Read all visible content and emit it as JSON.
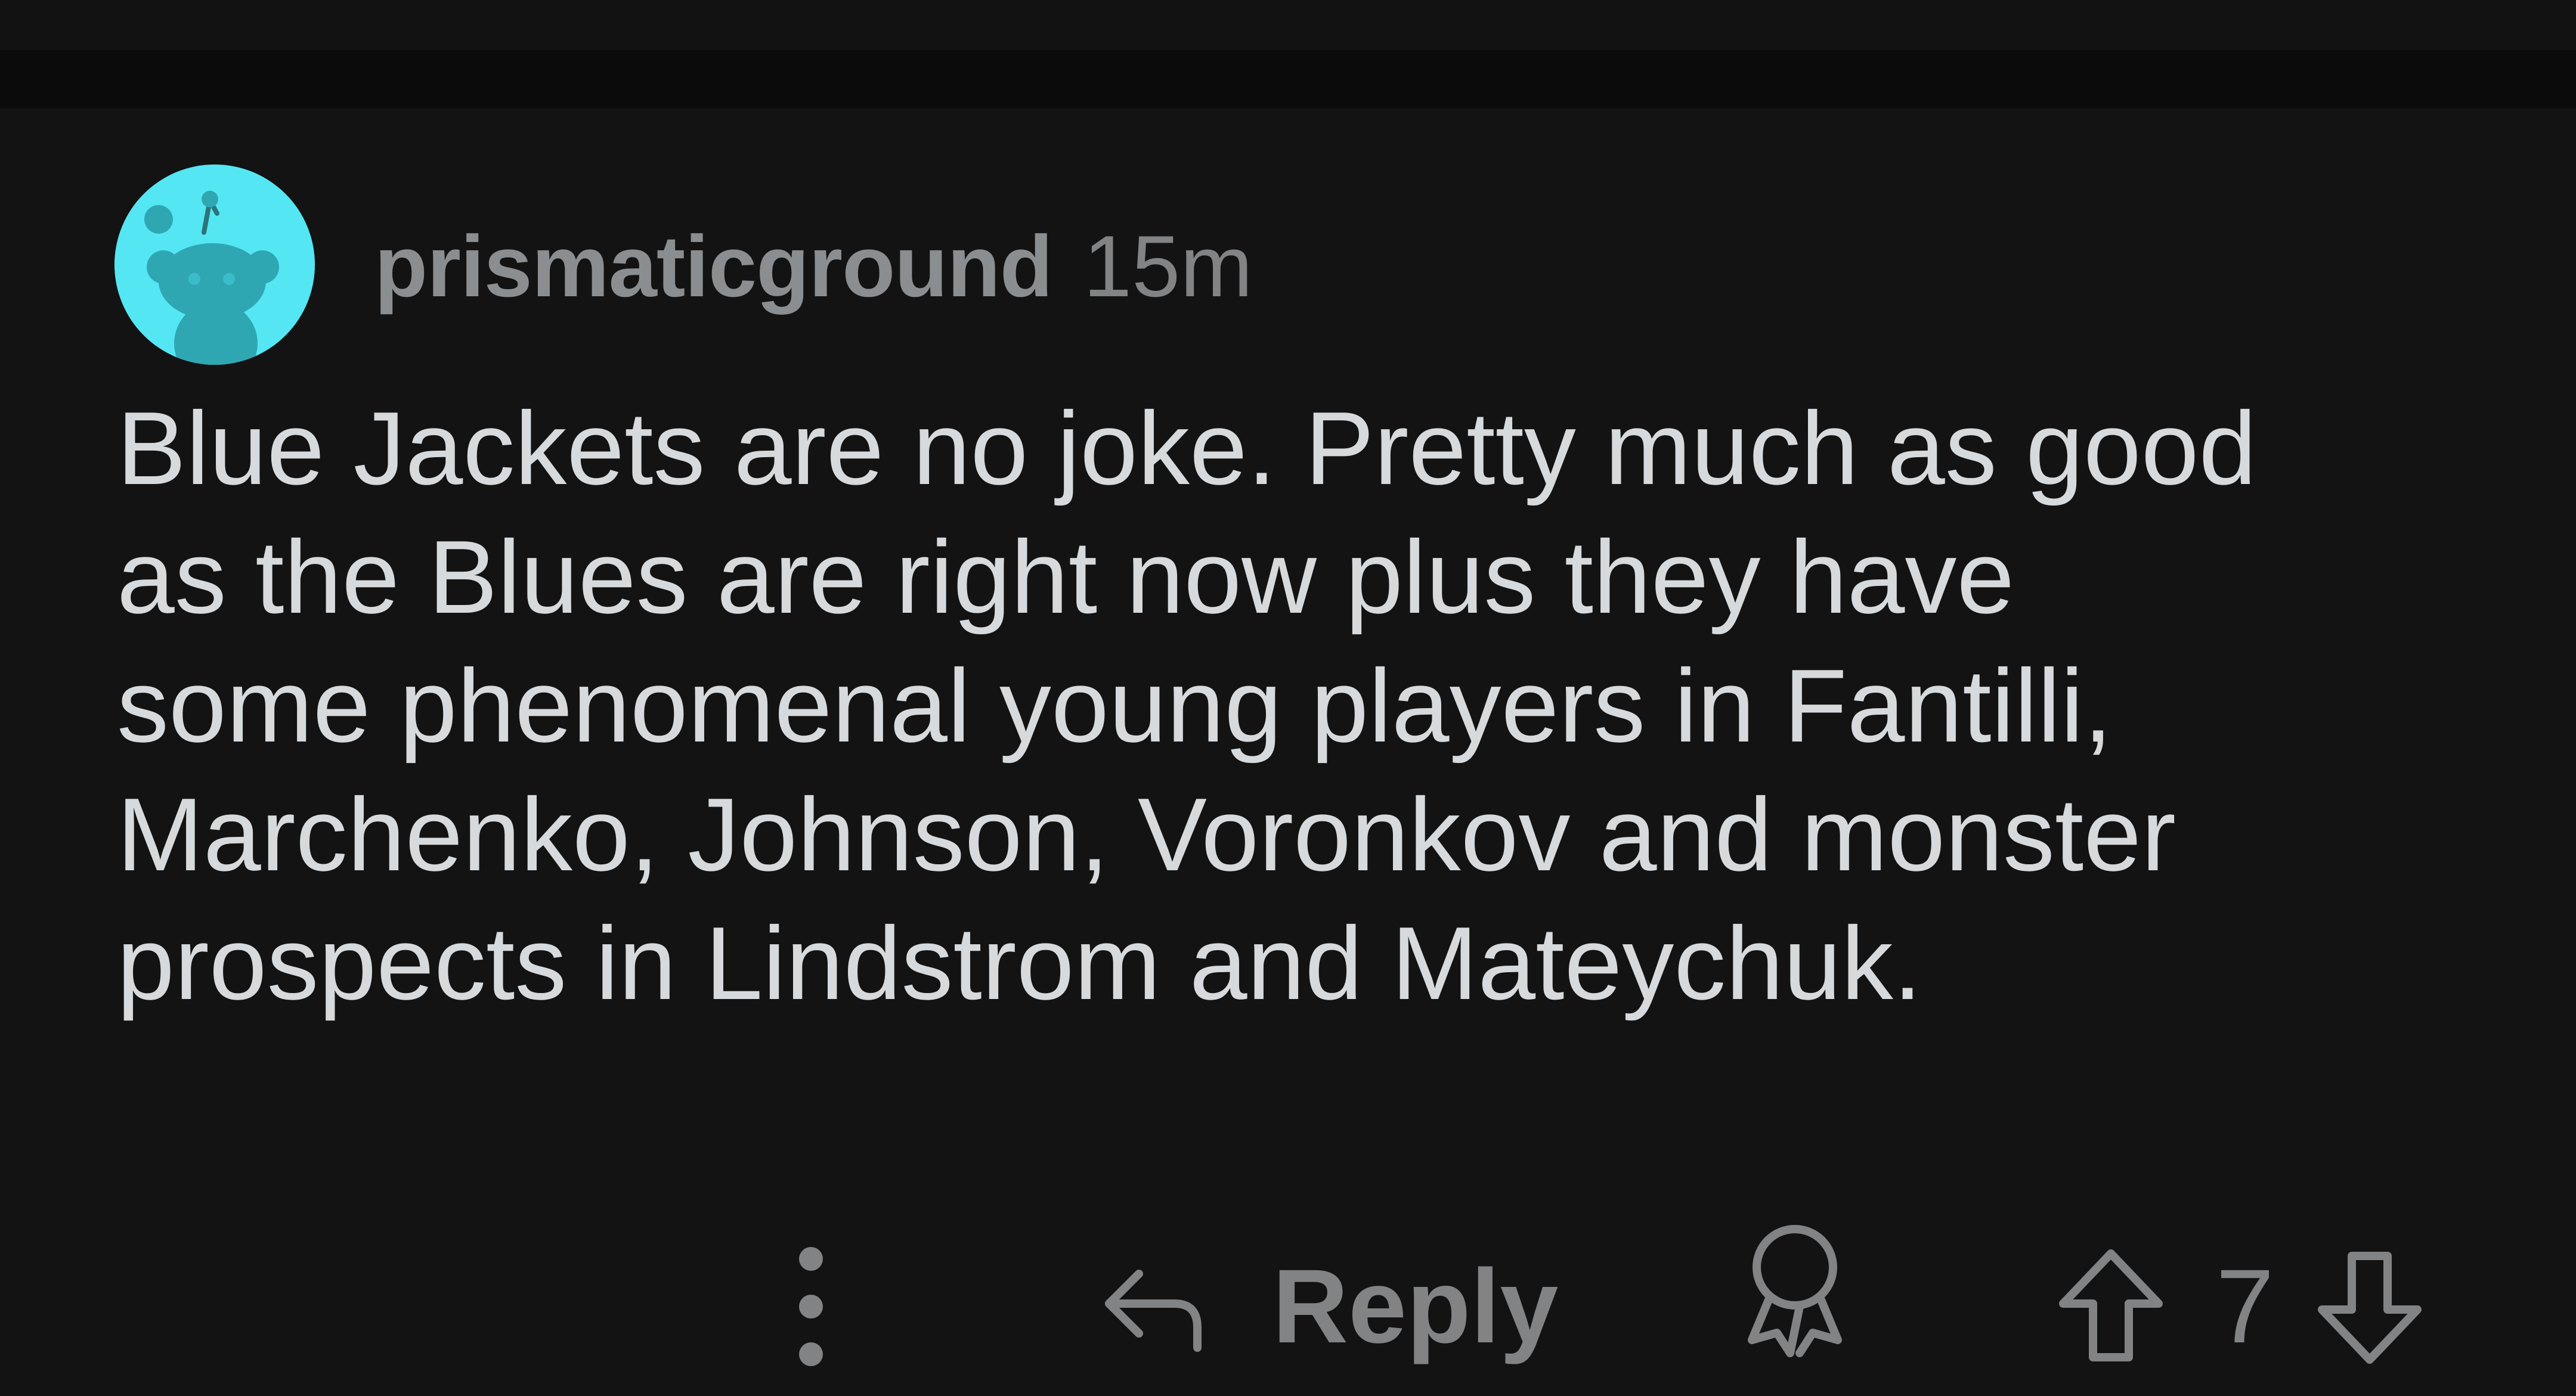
{
  "comment": {
    "author": "prismaticground",
    "timestamp": "15m",
    "body": "Blue Jackets are no joke. Pretty much as good\nas the Blues are right now plus they have\nsome phenomenal young players in Fantilli,\nMarchenko, Johnson, Voronkov and monster\nprospects in Lindstrom and Mateychuk.",
    "avatar_color": "#54e6f3"
  },
  "actions": {
    "more_icon": "more-vertical-icon",
    "reply_icon": "reply-arrow-icon",
    "reply_label": "Reply",
    "award_icon": "award-icon",
    "upvote_icon": "upvote-arrow-icon",
    "vote_count": "7",
    "downvote_icon": "downvote-arrow-icon"
  },
  "colors": {
    "background": "#131313",
    "text_primary": "#d7dadc",
    "text_muted": "#818384"
  }
}
